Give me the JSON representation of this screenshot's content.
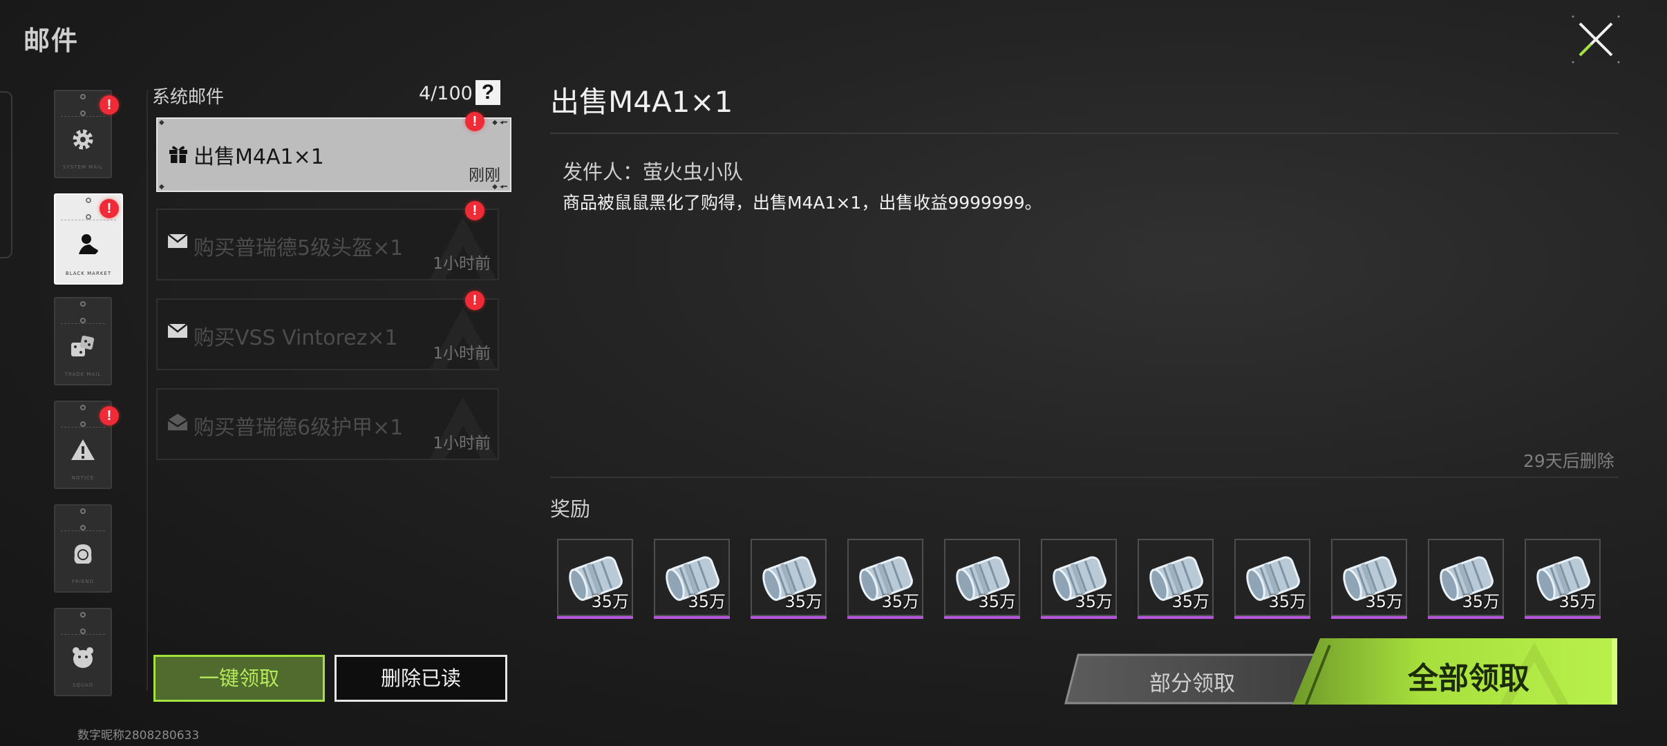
{
  "header": {
    "title": "邮件",
    "close_icon": "close-x-icon",
    "accent": "#a4e23f"
  },
  "categories": [
    {
      "icon": "gear-icon",
      "caption": "SYSTEM MAIL",
      "badge": "!",
      "active": false
    },
    {
      "icon": "black-market-icon",
      "caption": "BLACK MARKET",
      "badge": "!",
      "active": true
    },
    {
      "icon": "dice-icon",
      "caption": "TRADE MAIL",
      "badge": "",
      "active": false
    },
    {
      "icon": "warning-icon",
      "caption": "NOTICE",
      "badge": "!",
      "active": false
    },
    {
      "icon": "person-icon",
      "caption": "FRIEND",
      "badge": "",
      "active": false
    },
    {
      "icon": "bear-icon",
      "caption": "SQUAD",
      "badge": "",
      "active": false
    }
  ],
  "mail_list": {
    "title": "系统邮件",
    "count": "4/100",
    "help_label": "?",
    "items": [
      {
        "icon": "gift-icon",
        "title": "出售M4A1×1",
        "time": "刚刚",
        "unread_badge": "!",
        "active": true
      },
      {
        "icon": "envelope-icon",
        "title": "购买普瑞德5级头盔×1",
        "time": "1小时前",
        "unread_badge": "!",
        "active": false
      },
      {
        "icon": "envelope-icon",
        "title": "购买VSS Vintorez×1",
        "time": "1小时前",
        "unread_badge": "!",
        "active": false
      },
      {
        "icon": "envelope-open-icon",
        "title": "购买普瑞德6级护甲×1",
        "time": "1小时前",
        "unread_badge": "",
        "active": false
      }
    ]
  },
  "buttons": {
    "claim_one": "一键领取",
    "delete_read": "删除已读",
    "partial_claim": "部分领取",
    "claim_all": "全部领取"
  },
  "footer": {
    "nickname": "数字昵称2808280633"
  },
  "detail": {
    "title": "出售M4A1×1",
    "sender": "发件人：萤火虫小队",
    "body": "商品被鼠鼠黑化了购得，出售M4A1×1，出售收益9999999。",
    "expire": "29天后删除",
    "reward_label": "奖励",
    "rewards": [
      {
        "icon": "cash-bundle-icon",
        "amount": "35万",
        "rarity_color": "#b356d8"
      },
      {
        "icon": "cash-bundle-icon",
        "amount": "35万",
        "rarity_color": "#b356d8"
      },
      {
        "icon": "cash-bundle-icon",
        "amount": "35万",
        "rarity_color": "#b356d8"
      },
      {
        "icon": "cash-bundle-icon",
        "amount": "35万",
        "rarity_color": "#b356d8"
      },
      {
        "icon": "cash-bundle-icon",
        "amount": "35万",
        "rarity_color": "#b356d8"
      },
      {
        "icon": "cash-bundle-icon",
        "amount": "35万",
        "rarity_color": "#b356d8"
      },
      {
        "icon": "cash-bundle-icon",
        "amount": "35万",
        "rarity_color": "#b356d8"
      },
      {
        "icon": "cash-bundle-icon",
        "amount": "35万",
        "rarity_color": "#b356d8"
      },
      {
        "icon": "cash-bundle-icon",
        "amount": "35万",
        "rarity_color": "#b356d8"
      },
      {
        "icon": "cash-bundle-icon",
        "amount": "35万",
        "rarity_color": "#b356d8"
      },
      {
        "icon": "cash-bundle-icon",
        "amount": "35万",
        "rarity_color": "#b356d8"
      }
    ]
  }
}
